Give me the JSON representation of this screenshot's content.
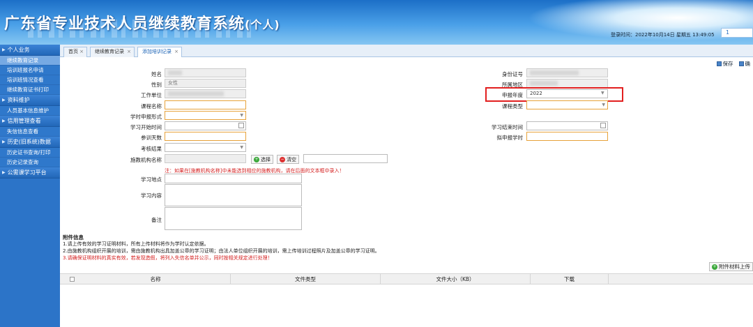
{
  "header": {
    "title": "广东省专业技术人员继续教育系统",
    "title_suffix": "(个人)",
    "login_info": "登录时间：2022年10月14日  星期五  13:49:05",
    "user_label": "1"
  },
  "sidebar": {
    "groups": [
      {
        "label": "个人业务",
        "items": [
          "继续教育记录",
          "培训班报名申请",
          "培训班情况查看",
          "继续教育证书打印"
        ]
      },
      {
        "label": "资料维护",
        "items": [
          "人员基本信息维护"
        ]
      },
      {
        "label": "信用管理查看",
        "items": [
          "失信信息查看"
        ]
      },
      {
        "label": "历史(旧系统)数据",
        "items": [
          "历史证书查询/打印",
          "历史记录查询"
        ]
      },
      {
        "label": "公需课学习平台",
        "items": []
      }
    ]
  },
  "tabs": [
    {
      "label": "首页"
    },
    {
      "label": "继续教育记录"
    },
    {
      "label": "添加培训记录"
    }
  ],
  "toolbar": {
    "save": "保存",
    "more": "确"
  },
  "form": {
    "name_label": "姓名",
    "gender_label": "性别",
    "gender_value": "女性",
    "workplace_label": "工作单位",
    "course_name_label": "课程名称",
    "hours_form_label": "学时申报形式",
    "study_start_label": "学习开始时间",
    "days_label": "参训天数",
    "exam_result_label": "考核结果",
    "org_name_label": "施教机构名称",
    "select_btn": "选择",
    "clear_btn": "清空",
    "org_note": "注：如果在[施教机构名称]中未能选到相应的施教机构，请在后面的文本框中录入！",
    "study_place_label": "学习地点",
    "study_content_label": "学习内容",
    "remark_label": "备注",
    "id_label": "身份证号",
    "region_label": "所属地区",
    "year_label": "申报年度",
    "year_value": "2022",
    "course_type_label": "课程类型",
    "study_end_label": "学习结束时间",
    "planned_hours_label": "拟申报学时"
  },
  "attachments": {
    "title": "附件信息",
    "line1": "1.请上传有效的学习证明材料，所有上传材料将作为学时认定依据。",
    "line2": "2.由施教机构组织开展的培训，需由施教机构出具加盖公章的学习证明；由法人单位组织开展的培训，需上传培训过程照片及加盖公章的学习证明。",
    "line3": "3.请确保证明材料的真实有效，若发现造假，将列入失信名单并公示，同时按相关规定进行处理！",
    "upload_btn": "附件材料上传",
    "columns": [
      "名称",
      "文件类型",
      "文件大小（KB）",
      "下载"
    ]
  }
}
